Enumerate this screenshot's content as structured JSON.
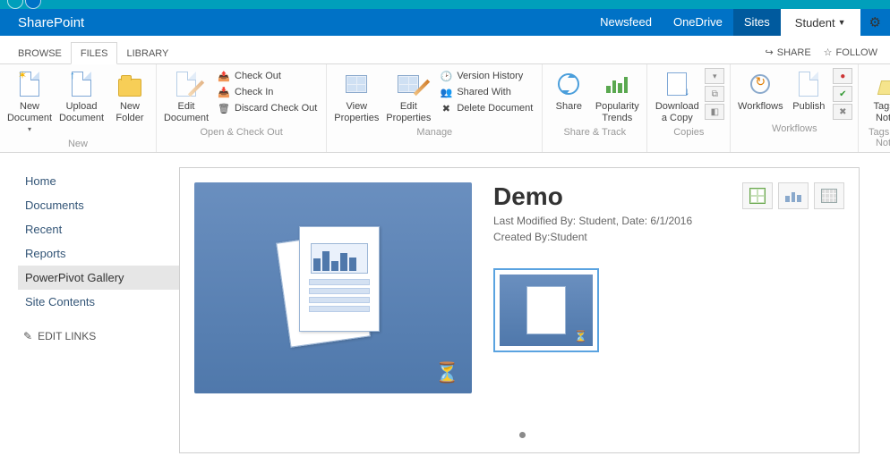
{
  "suite": {
    "brand": "SharePoint",
    "links": [
      "Newsfeed",
      "OneDrive",
      "Sites"
    ],
    "active_link_index": 2,
    "user": "Student"
  },
  "tabs": {
    "items": [
      "BROWSE",
      "FILES",
      "LIBRARY"
    ],
    "active_index": 1,
    "share": "SHARE",
    "follow": "FOLLOW"
  },
  "ribbon": {
    "groups": {
      "new": {
        "label": "New",
        "new_document": "New Document",
        "upload_document": "Upload Document",
        "new_folder": "New Folder"
      },
      "open": {
        "label": "Open & Check Out",
        "edit_document": "Edit Document",
        "check_out": "Check Out",
        "check_in": "Check In",
        "discard": "Discard Check Out"
      },
      "manage": {
        "label": "Manage",
        "view_properties": "View Properties",
        "edit_properties": "Edit Properties",
        "version_history": "Version History",
        "shared_with": "Shared With",
        "delete_document": "Delete Document"
      },
      "share_track": {
        "label": "Share & Track",
        "share": "Share",
        "popularity_trends": "Popularity Trends"
      },
      "copies": {
        "label": "Copies",
        "download_copy": "Download a Copy"
      },
      "workflows": {
        "label": "Workflows",
        "workflows": "Workflows",
        "publish": "Publish"
      },
      "tags": {
        "label": "Tags and Notes",
        "tags_notes": "Tags & Notes"
      }
    }
  },
  "nav": {
    "items": [
      "Home",
      "Documents",
      "Recent",
      "Reports",
      "PowerPivot Gallery",
      "Site Contents"
    ],
    "selected_index": 4,
    "edit_links": "EDIT LINKS"
  },
  "document": {
    "title": "Demo",
    "modified_line": "Last Modified By: Student,  Date: 6/1/2016",
    "created_line": "Created By:Student"
  }
}
